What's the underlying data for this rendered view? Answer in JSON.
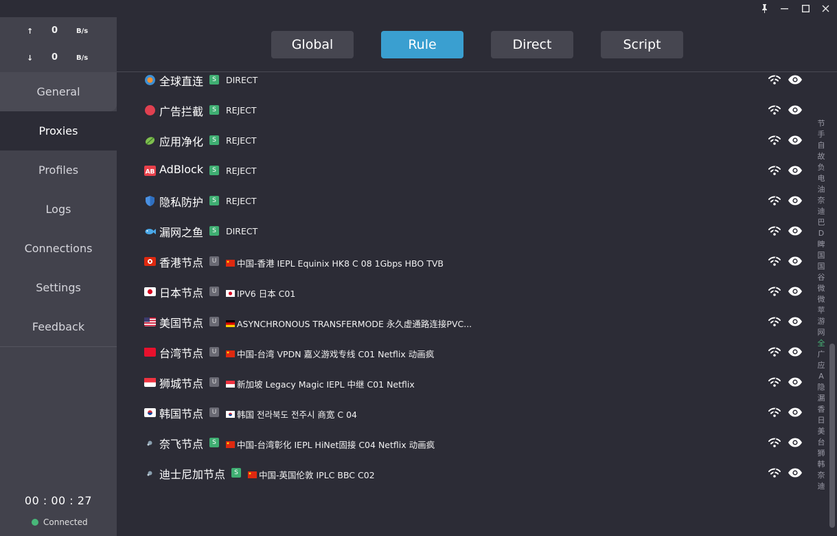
{
  "window": {
    "pin_icon": "pin-icon",
    "minimize_icon": "minimize-icon",
    "maximize_icon": "maximize-icon",
    "close_icon": "close-icon"
  },
  "traffic": {
    "up_arrow": "↑",
    "up_value": "0",
    "up_unit": "B/s",
    "down_arrow": "↓",
    "down_value": "0",
    "down_unit": "B/s"
  },
  "nav": {
    "general": "General",
    "proxies": "Proxies",
    "profiles": "Profiles",
    "logs": "Logs",
    "connections": "Connections",
    "settings": "Settings",
    "feedback": "Feedback"
  },
  "footer": {
    "timer": "00 : 00 : 27",
    "status": "Connected"
  },
  "modes": {
    "global": "Global",
    "rule": "Rule",
    "direct": "Direct",
    "script": "Script",
    "active": "Rule"
  },
  "groups": [
    {
      "name": "全球直连",
      "type": "S",
      "now": "DIRECT",
      "icon": "globe-icon"
    },
    {
      "name": "广告拦截",
      "type": "S",
      "now": "REJECT",
      "icon": "stop-icon"
    },
    {
      "name": "应用净化",
      "type": "S",
      "now": "REJECT",
      "icon": "leaf-icon"
    },
    {
      "name": "AdBlock",
      "type": "S",
      "now": "REJECT",
      "icon": "ab-icon"
    },
    {
      "name": "隐私防护",
      "type": "S",
      "now": "REJECT",
      "icon": "shield-icon"
    },
    {
      "name": "漏网之鱼",
      "type": "S",
      "now": "DIRECT",
      "icon": "fish-icon"
    },
    {
      "name": "香港节点",
      "type": "U",
      "now": "中国-香港 IEPL Equinix HK8 C 08 1Gbps HBO TVB",
      "icon": "hk-flag-icon"
    },
    {
      "name": "日本节点",
      "type": "U",
      "now": "IPV6 日本 C01",
      "icon": "jp-flag-icon"
    },
    {
      "name": "美国节点",
      "type": "U",
      "now": "ASYNCHRONOUS TRANSFERMODE 永久虚通路连接PVC...",
      "icon": "us-flag-icon"
    },
    {
      "name": "台湾节点",
      "type": "U",
      "now": "中国-台湾 VPDN 嘉义游戏专线 C01 Netflix 动画疯",
      "icon": "tw-flag-icon"
    },
    {
      "name": "狮城节点",
      "type": "U",
      "now": "新加坡 Legacy Magic IEPL 中继 C01 Netflix",
      "icon": "sg-flag-icon"
    },
    {
      "name": "韩国节点",
      "type": "U",
      "now": "韩国 전라북도 전주시 商宽 C 04",
      "icon": "kr-flag-icon"
    },
    {
      "name": "奈飞节点",
      "type": "S",
      "now": "中国-台湾彰化 IEPL HiNet固接 C04 Netflix 动画疯",
      "icon": "netflix-icon"
    },
    {
      "name": "迪士尼加节点",
      "type": "S",
      "now": "中国-英国伦敦 IPLC BBC C02",
      "icon": "disney-icon"
    }
  ],
  "index_letters": [
    "节",
    "手",
    "自",
    "故",
    "负",
    "电",
    "油",
    "奈",
    "迪",
    "巴",
    "D",
    "睥",
    "国",
    "国",
    "谷",
    "微",
    "微",
    "苹",
    "游",
    "网",
    "全",
    "广",
    "应",
    "A",
    "隐",
    "漏",
    "香",
    "日",
    "美",
    "台",
    "狮",
    "韩",
    "奈",
    "迪"
  ],
  "index_highlight": "全",
  "colors": {
    "accent": "#3a9fd0",
    "connected": "#48b779",
    "select_badge": "#3fae72",
    "urltest_badge": "#6a6a74"
  }
}
